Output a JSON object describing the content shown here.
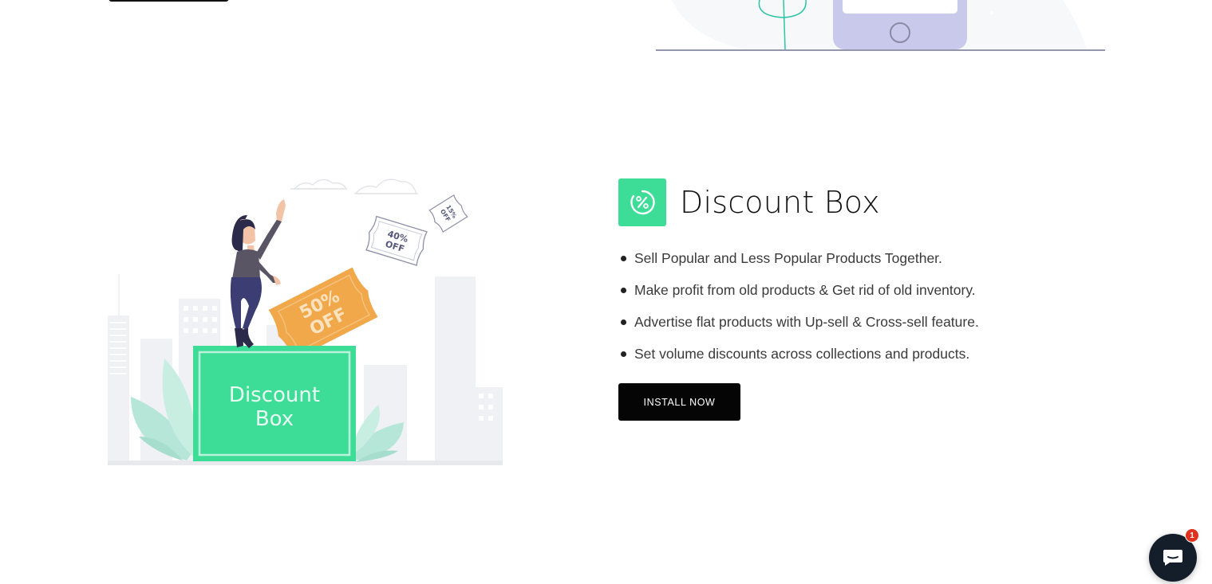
{
  "illustration": {
    "box_label_line1": "Discount",
    "box_label_line2": "Box",
    "ticket_large_line1": "50%",
    "ticket_large_line2": "OFF",
    "ticket_medium_line1": "40%",
    "ticket_medium_line2": "OFF",
    "ticket_small_line1": "15%",
    "ticket_small_line2": "OFF"
  },
  "feature": {
    "icon": "percent-badge-icon",
    "title": "Discount Box",
    "bullets": [
      "Sell Popular and Less Popular Products Together.",
      "Make profit from old products & Get rid of old inventory.",
      "Advertise flat products with Up-sell & Cross-sell feature.",
      "Set volume discounts across collections and products."
    ],
    "install_label": "INSTALL NOW"
  },
  "chat": {
    "icon": "chat-bubble-icon",
    "badge_count": "1"
  },
  "colors": {
    "accent_green": "#3ddc97",
    "ticket_orange": "#f0a84a",
    "button_black": "#050505",
    "chat_navy": "#141e2b",
    "badge_red": "#e0301e",
    "phone_lavender": "#c9c9ec"
  }
}
